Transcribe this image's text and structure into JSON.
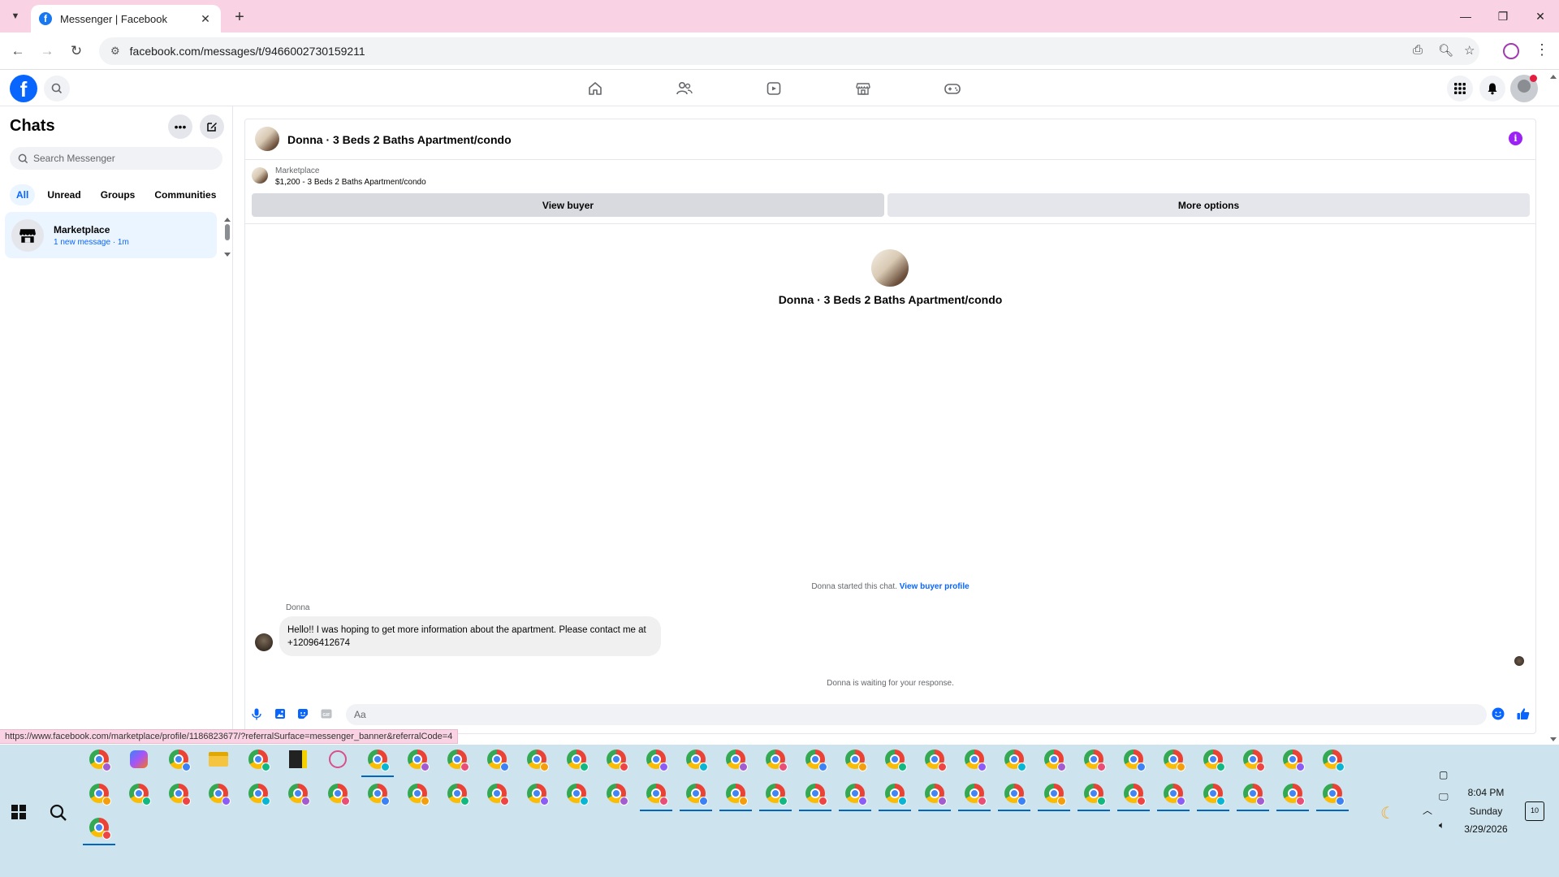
{
  "browser": {
    "tab_title": "Messenger | Facebook",
    "url": "facebook.com/messages/t/9466002730159211",
    "status_url": "https://www.facebook.com/marketplace/profile/1186823677/?referralSurface=messenger_banner&referralCode=4"
  },
  "sidebar": {
    "title": "Chats",
    "search_placeholder": "Search Messenger",
    "filters": [
      "All",
      "Unread",
      "Groups",
      "Communities"
    ],
    "chat": {
      "name": "Marketplace",
      "meta": "1 new message · 1m"
    }
  },
  "conversation": {
    "title": "Donna · 3 Beds 2 Baths Apartment/condo",
    "marketplace_label": "Marketplace",
    "listing": "$1,200 - 3 Beds 2 Baths Apartment/condo",
    "view_buyer": "View buyer",
    "more_options": "More options",
    "intro_name": "Donna · 3 Beds 2 Baths Apartment/condo",
    "started_text": "Donna started this chat.",
    "view_buyer_profile": "View buyer profile",
    "sender": "Donna",
    "message": "Hello!! I was hoping to get more information about the apartment. Please contact me at +12096412674",
    "waiting": "Donna is waiting for your response.",
    "composer_placeholder": "Aa"
  },
  "taskbar": {
    "time": "8:04 PM",
    "day": "Sunday",
    "date": "3/29/2026",
    "notifications": "10"
  },
  "colors": {
    "accent": "#0866ff",
    "info": "#9b21f5",
    "tabstrip": "#f9d3e3",
    "taskbar": "#cde3ee"
  }
}
